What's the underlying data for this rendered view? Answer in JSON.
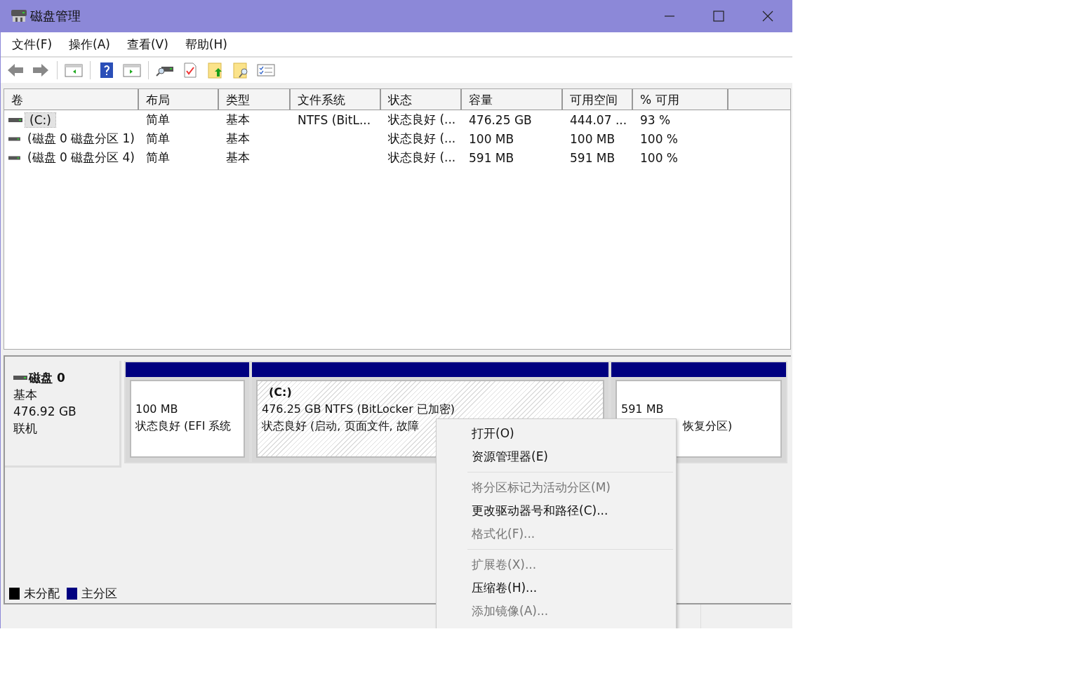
{
  "window": {
    "title": "磁盘管理"
  },
  "menu_bar": [
    "文件(F)",
    "操作(A)",
    "查看(V)",
    "帮助(H)"
  ],
  "table": {
    "columns": [
      "卷",
      "布局",
      "类型",
      "文件系统",
      "状态",
      "容量",
      "可用空间",
      "% 可用"
    ],
    "rows": [
      {
        "selected": true,
        "cells": [
          "(C:)",
          "简单",
          "基本",
          "NTFS (BitL...",
          "状态良好 (...",
          "476.25 GB",
          "444.07 ...",
          "93 %"
        ]
      },
      {
        "selected": false,
        "cells": [
          "(磁盘 0 磁盘分区 1)",
          "简单",
          "基本",
          "",
          "状态良好 (...",
          "100 MB",
          "100 MB",
          "100 %"
        ]
      },
      {
        "selected": false,
        "cells": [
          "(磁盘 0 磁盘分区 4)",
          "简单",
          "基本",
          "",
          "状态良好 (...",
          "591 MB",
          "591 MB",
          "100 %"
        ]
      }
    ]
  },
  "disk": {
    "name": "磁盘 0",
    "type": "基本",
    "size": "476.92 GB",
    "status": "联机",
    "partitions": [
      {
        "selected": false,
        "size": "100 MB",
        "status": "状态良好 (EFI 系统"
      },
      {
        "selected": true,
        "label": "(C:)",
        "size": "476.25 GB NTFS (BitLocker 已加密)",
        "status": "状态良好 (启动, 页面文件, 故障"
      },
      {
        "selected": false,
        "size": "591 MB",
        "status": "恢复分区)"
      }
    ]
  },
  "legend": [
    {
      "label": "未分配",
      "color": "#000000"
    },
    {
      "label": "主分区",
      "color": "#000080"
    }
  ],
  "context_menu": [
    {
      "label": "打开(O)",
      "disabled": false,
      "separator_after": false
    },
    {
      "label": "资源管理器(E)",
      "disabled": false,
      "separator_after": true
    },
    {
      "label": "将分区标记为活动分区(M)",
      "disabled": true,
      "separator_after": false
    },
    {
      "label": "更改驱动器号和路径(C)...",
      "disabled": false,
      "separator_after": false
    },
    {
      "label": "格式化(F)...",
      "disabled": true,
      "separator_after": true
    },
    {
      "label": "扩展卷(X)...",
      "disabled": true,
      "separator_after": false
    },
    {
      "label": "压缩卷(H)...",
      "disabled": false,
      "separator_after": false
    },
    {
      "label": "添加镜像(A)...",
      "disabled": true,
      "separator_after": false
    }
  ]
}
